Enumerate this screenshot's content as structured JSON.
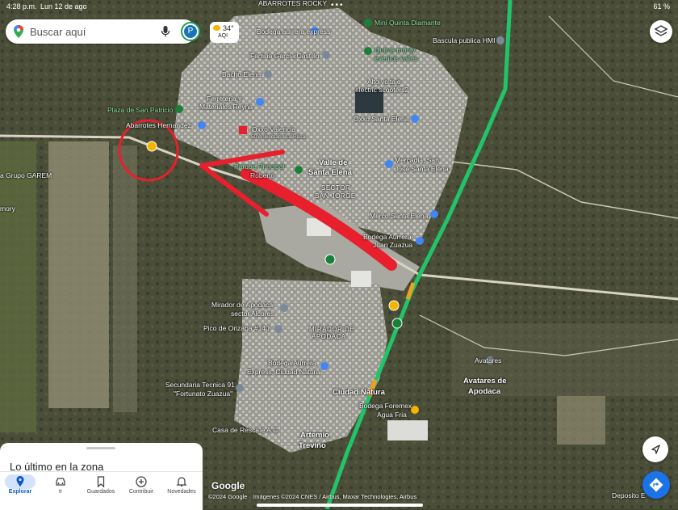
{
  "status_bar": {
    "time": "4:28 p.m.",
    "date": "Lun 12 de ago",
    "battery": "61 %",
    "dots": "•••"
  },
  "search": {
    "placeholder": "Buscar aquí",
    "avatar_letter": "P"
  },
  "weather": {
    "temp": "34°",
    "aqi": "AQI"
  },
  "map_labels": {
    "abarrotes_rocky": "ABARROTES ROCKY",
    "bodega_express": "Bodega aurrera express",
    "mini_quinta": "Mini Quinta Diamante",
    "quinta_monty_1": "Quinta monty",
    "quinta_monty_2": "eventos valles",
    "bascula": "Bascula publica HMI",
    "familia_garcia": "Familia García Castillo",
    "bacho_elena": "Bacho Elena",
    "alto_voltaje_1": "Alto voltaje",
    "alto_voltaje_2": "electric scooters2",
    "ferreteria_1": "Ferreteria y",
    "ferreteria_2": "Materiales Reyna",
    "plaza_san_patricio": "Plaza de San Patricio",
    "oxxo_santa_elena": "Oxxo Santa Elena",
    "abarrotes_hernandez": "Abarrotes Hernandez",
    "oxxo_valencia": "Oxxo Valencia",
    "aniversario": "50 Aniversario La Rosa",
    "valle_1": "Valle de",
    "valle_2": "Santa Elena",
    "mercadia_1": "Mercadia, San",
    "mercadia_2": "José Santa Elena",
    "parque_1": "Parque Principal",
    "parque_2": "Roberto",
    "sector_1": "SECTOR",
    "sector_2": "SAN JORGE",
    "grupo_garem": "a Grupo GAREM",
    "memory": "mory",
    "merco": "Merco Santa Elena",
    "bodega_juan_1": "Bodega Aurrera",
    "bodega_juan_2": "Juan Zuazua",
    "mirador_apodaca_1": "Mirador de Apodaca",
    "mirador_apodaca_2": "sector Alcores",
    "pico_orizaba": "Pico de Orizaba #140",
    "mirador_de_1": "MIRADOR DE",
    "mirador_de_2": "APODACA",
    "avatares": "Avatares",
    "avatares_apodaca_1": "Avatares de",
    "avatares_apodaca_2": "Apodaca",
    "bodega_natura_1": "Bodega Aurrera",
    "bodega_natura_2": "Express, Ciudad Natura",
    "secundaria_1": "Secundaria Tecnica 91",
    "secundaria_2": "\"Fortunato Zuazua\"",
    "ciudad_natura": "Ciudad Natura",
    "bodega_foremex_1": "Bodega Foremex",
    "bodega_foremex_2": "Agua Fria",
    "casa_rescate": "Casa de Rescate A.C.",
    "artemio_1": "Artemio",
    "artemio_2": "Treviño",
    "deposito": "Deposito E"
  },
  "bottom_sheet": {
    "title": "Lo último en la zona"
  },
  "tabs": [
    {
      "label": "Explorar",
      "icon": "pin-icon",
      "active": true
    },
    {
      "label": "Ir",
      "icon": "car-icon"
    },
    {
      "label": "Guardados",
      "icon": "bookmark-icon"
    },
    {
      "label": "Contribuir",
      "icon": "plus-circle-icon"
    },
    {
      "label": "Novedades",
      "icon": "bell-icon"
    }
  ],
  "google_logo": "Google",
  "attribution": "©2024 Google · Imágenes ©2024 CNES / Airbus, Maxar Technologies, Airbus",
  "colors": {
    "annotation_red": "#e8202e",
    "road_green": "#21c46a",
    "accent_blue": "#1a73e8"
  }
}
